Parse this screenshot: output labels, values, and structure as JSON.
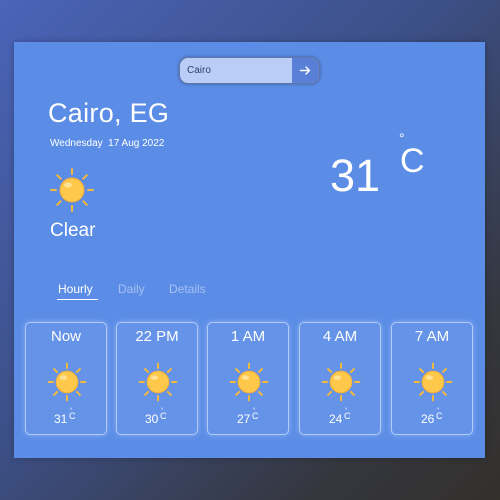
{
  "search": {
    "value": "Cairo"
  },
  "location": "Cairo, EG",
  "date": "Wednesday  17 Aug 2022",
  "condition": "Clear",
  "current": {
    "temp": "31",
    "degree": "°",
    "unit": "C"
  },
  "tabs": [
    {
      "label": "Hourly",
      "active": true
    },
    {
      "label": "Daily",
      "active": false
    },
    {
      "label": "Details",
      "active": false
    }
  ],
  "forecast": [
    {
      "time": "Now",
      "temp": "31",
      "degree": "°",
      "unit": "C"
    },
    {
      "time": "22 PM",
      "temp": "30",
      "degree": "°",
      "unit": "C"
    },
    {
      "time": "1 AM",
      "temp": "27",
      "degree": "°",
      "unit": "C"
    },
    {
      "time": "4 AM",
      "temp": "24",
      "degree": "°",
      "unit": "C"
    },
    {
      "time": "7 AM",
      "temp": "26",
      "degree": "°",
      "unit": "C"
    }
  ],
  "colors": {
    "card": "#5b8de6",
    "sun": "#ffc84a",
    "rays": "#f7b93a"
  }
}
